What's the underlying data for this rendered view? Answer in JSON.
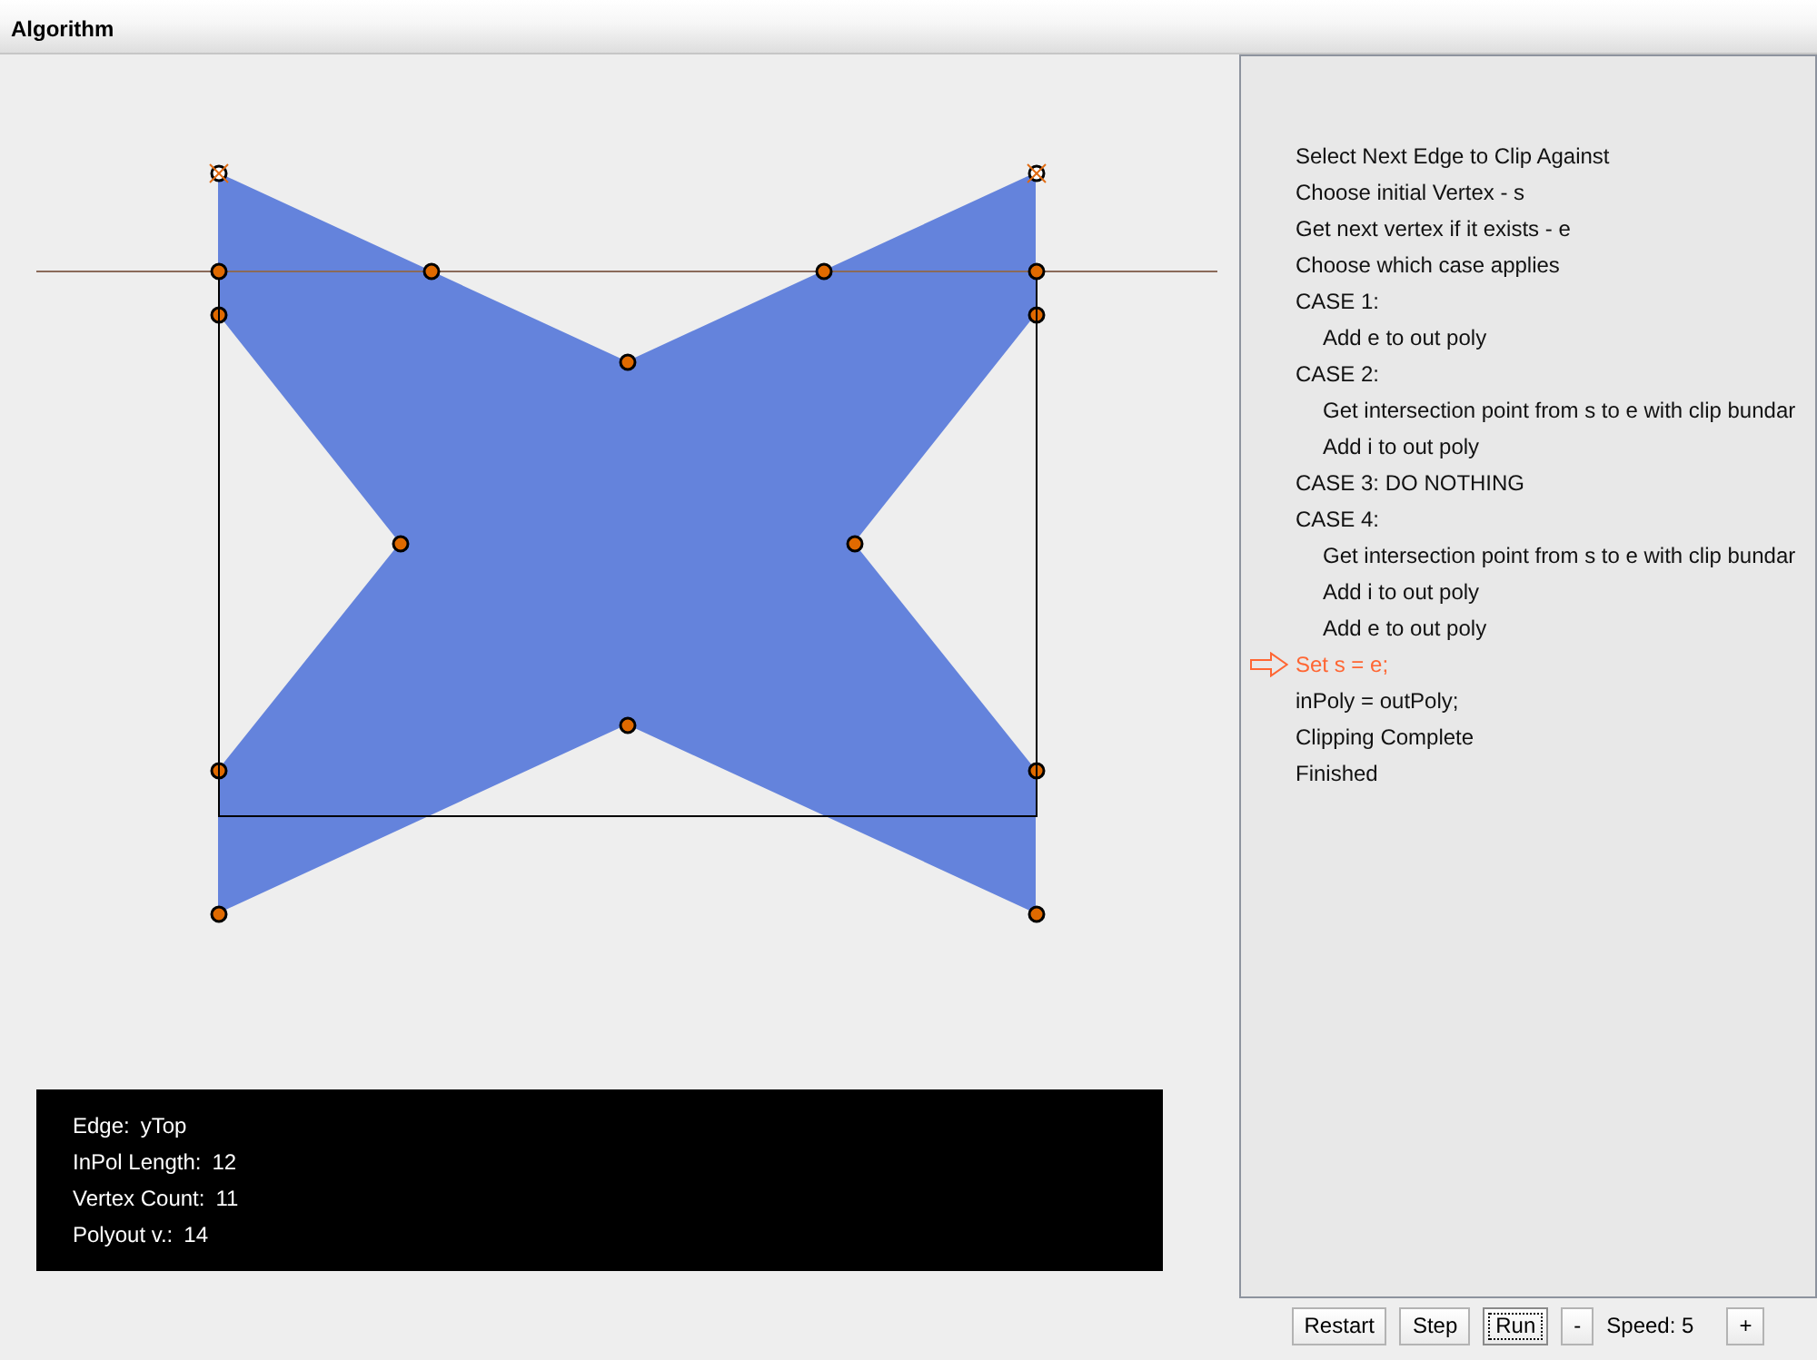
{
  "window": {
    "title": "Algorithm"
  },
  "info_box": {
    "rows": [
      {
        "label": "Edge:",
        "value": "yTop"
      },
      {
        "label": "InPol Length:",
        "value": "12"
      },
      {
        "label": "Vertex Count:",
        "value": "11"
      },
      {
        "label": "Polyout v.:",
        "value": "14"
      }
    ]
  },
  "steps": [
    {
      "text": "Select Next Edge to Clip Against",
      "selected": false
    },
    {
      "text": "Choose initial Vertex - s",
      "selected": false
    },
    {
      "text": "Get next vertex if it exists - e",
      "selected": false
    },
    {
      "text": "Choose which case applies",
      "selected": false
    },
    {
      "text": "CASE 1:",
      "selected": false,
      "children": [
        {
          "text": "Add e to out poly",
          "selected": false
        }
      ]
    },
    {
      "text": "CASE 2:",
      "selected": false,
      "children": [
        {
          "text": "Get intersection point from s to e with clip bundar",
          "selected": false
        },
        {
          "text": "Add i to out poly",
          "selected": false
        }
      ]
    },
    {
      "text": "CASE 3: DO NOTHING",
      "selected": false
    },
    {
      "text": "CASE 4:",
      "selected": false,
      "children": [
        {
          "text": "Get intersection point from s to e with clip bundar",
          "selected": false
        },
        {
          "text": "Add i to out poly",
          "selected": false
        },
        {
          "text": "Add e to out poly",
          "selected": false
        }
      ]
    },
    {
      "text": "Set s = e;",
      "selected": true
    },
    {
      "text": "inPoly = outPoly;",
      "selected": false
    },
    {
      "text": "Clipping Complete",
      "selected": false
    },
    {
      "text": "Finished",
      "selected": false
    }
  ],
  "controls": [
    {
      "kind": "button",
      "label": "Restart",
      "focused": false
    },
    {
      "kind": "button",
      "label": "Step",
      "focused": false
    },
    {
      "kind": "button",
      "label": "Run",
      "focused": true
    },
    {
      "kind": "button",
      "label": "-",
      "focused": false
    },
    {
      "kind": "label",
      "label": "Speed: 5"
    },
    {
      "kind": "button",
      "label": "+",
      "focused": false
    }
  ]
}
